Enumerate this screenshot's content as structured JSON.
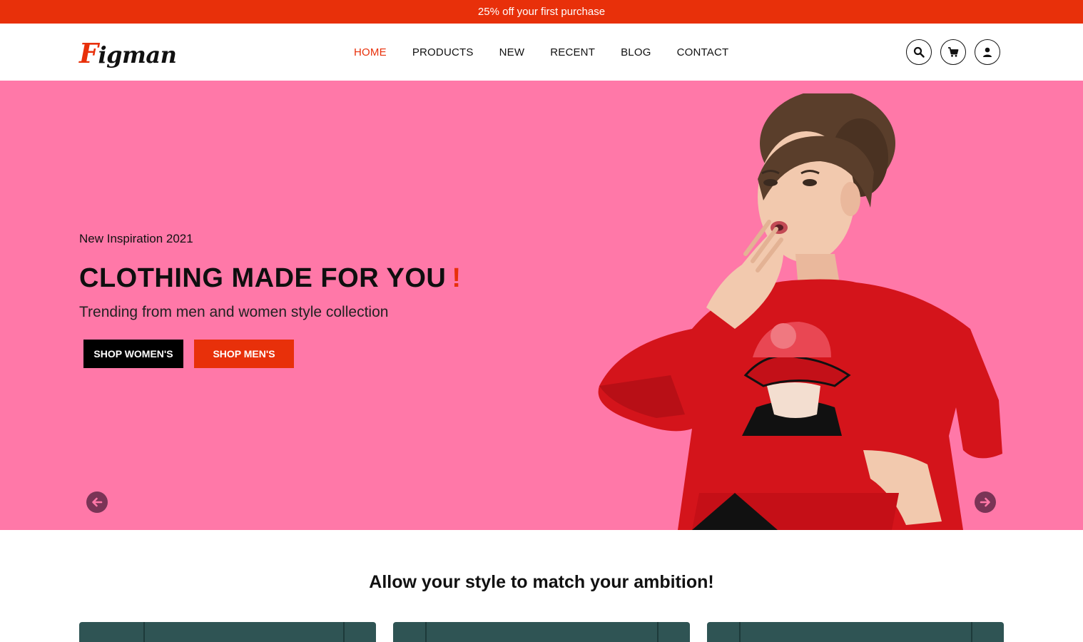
{
  "promo": {
    "text": "25% off your first purchase"
  },
  "header": {
    "logo_first": "F",
    "logo_rest": "igman",
    "nav": [
      {
        "label": "HOME",
        "active": true
      },
      {
        "label": "PRODUCTS",
        "active": false
      },
      {
        "label": "NEW",
        "active": false
      },
      {
        "label": "RECENT",
        "active": false
      },
      {
        "label": "BLOG",
        "active": false
      },
      {
        "label": "CONTACT",
        "active": false
      }
    ],
    "icons": [
      "search-icon",
      "cart-icon",
      "user-icon"
    ]
  },
  "hero": {
    "subtitle": "New Inspiration 2021",
    "title": "CLOTHING MADE FOR YOU",
    "title_accent": "!",
    "description": "Trending from men and women style collection",
    "btn_women": "SHOP WOMEN'S",
    "btn_men": "SHOP MEN'S",
    "bg_color": "#ff78a8",
    "accent_color": "#e8300a"
  },
  "section": {
    "tagline": "Allow your style to match your ambition!"
  }
}
